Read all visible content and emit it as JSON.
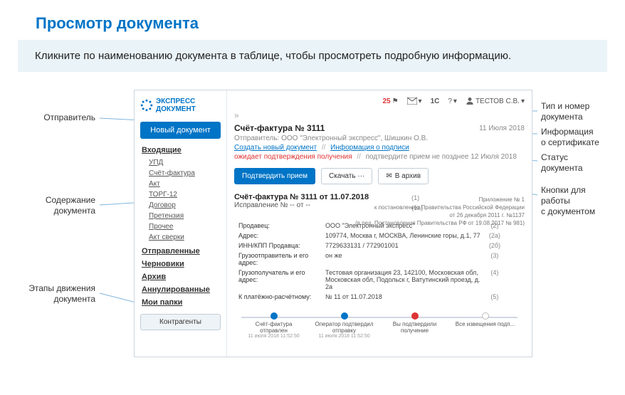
{
  "page": {
    "title": "Просмотр документа",
    "hint": "Кликните по наименованию документа в таблице, чтобы просмотреть подробную информацию."
  },
  "callouts": {
    "sender": "Отправитель",
    "content": "Содержание\nдокумента",
    "steps": "Этапы движения\nдокумента",
    "typeno": "Тип и номер\nдокумента",
    "cert": "Информация\nо сертификате",
    "status": "Статус\nдокумента",
    "buttons": "Кнопки для\nработы\nс документом"
  },
  "logo": {
    "line1": "ЭКСПРЕСС",
    "line2": "ДОКУМЕНТ"
  },
  "sidebar": {
    "new_doc": "Новый документ",
    "contractors": "Контрагенты",
    "groups": [
      {
        "label": "Входящие",
        "items": [
          "УПД",
          "Счёт-фактура",
          "Акт",
          "ТОРГ-12",
          "Договор",
          "Претензия",
          "Прочее",
          "Акт сверки"
        ]
      },
      {
        "label": "Отправленные",
        "items": []
      },
      {
        "label": "Черновики",
        "items": []
      },
      {
        "label": "Архив",
        "items": []
      },
      {
        "label": "Аннулированные",
        "items": []
      },
      {
        "label": "Мои папки",
        "items": []
      }
    ]
  },
  "topbar": {
    "badge25": "25",
    "oneC": "1С",
    "help": "?",
    "user": "ТЕСТОВ С.В.",
    "caret": "▾"
  },
  "doc": {
    "title": "Счёт-фактура № 3111",
    "date": "11 Июля 2018",
    "sender": "Отправитель: ООО \"Электронный экспресс\", Шишкин О.В.",
    "links": {
      "create": "Создать новый документ",
      "sign": "Информация о подписи"
    },
    "slash": "//",
    "status_wait": "ожидает подтверждения получения",
    "status_note_prefix": "подтвердите прием не позднее ",
    "status_note_date": "12 Июля 2018",
    "actions": {
      "confirm": "Подтвердить прием",
      "download": "Скачать ···",
      "archive": "В архив"
    },
    "body_title": "Счёт-фактура № 3111 от 11.07.2018",
    "body_correction": "Исправление № -- от --",
    "idx1": "(1)",
    "idx1a": "(1a)",
    "right_meta": [
      "Приложение № 1",
      "к постановлению Правительства Российской Федерации",
      "от 26 декабря 2011 г. №1137",
      "(в ред. Постановления Правительства РФ от 19.08.2017 № 981)"
    ],
    "kv": [
      {
        "k": "Продавец:",
        "v": "ООО \"Электронный экспресс\"",
        "i": "(2)"
      },
      {
        "k": "Адрес:",
        "v": "109774, Москва г, МОСКВА, Ленинские горы, д.1, 77",
        "i": "(2а)"
      },
      {
        "k": "ИНН/КПП Продавца:",
        "v": "7729633131 / 772901001",
        "i": "(2б)"
      },
      {
        "k": "Грузоотправитель и его адрес:",
        "v": "он же",
        "i": "(3)"
      },
      {
        "k": "Грузополучатель и его адрес:",
        "v": "Тестовая организация 23, 142100, Московская обл, Московская обл, Подольск г, Ватутинский проезд, д. 2а",
        "i": "(4)"
      },
      {
        "k": "К платёжно-расчётному:",
        "v": "№ 11 от 11.07.2018",
        "i": "(5)"
      }
    ],
    "stepper": [
      {
        "label": "Счёт-фактура отправлен",
        "time": "11 июля 2018 11:52:50",
        "state": "done"
      },
      {
        "label": "Оператор подтвердил отправку",
        "time": "11 июля 2018 11:52:50",
        "state": "done"
      },
      {
        "label": "Вы подтвердили получение",
        "time": "",
        "state": "err"
      },
      {
        "label": "Все извещения подп...",
        "time": "",
        "state": ""
      }
    ]
  }
}
